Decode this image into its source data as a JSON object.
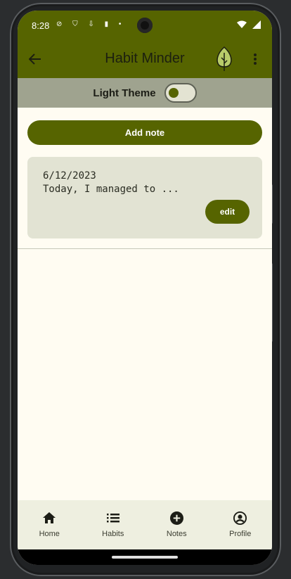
{
  "status_bar": {
    "time": "8:28",
    "icons": "⊘ ⛉ ⇩ ▮ •"
  },
  "app_bar": {
    "title": "Habit Minder",
    "back_icon": "arrow-back-icon",
    "logo_icon": "leaf-logo-icon",
    "more_icon": "more-vert-icon"
  },
  "theme": {
    "label": "Light Theme",
    "toggle_on": false
  },
  "add_note_label": "Add note",
  "notes": [
    {
      "date": "6/12/2023",
      "text": "Today, I managed to ...",
      "edit_label": "edit"
    }
  ],
  "bottom_nav": [
    {
      "label": "Home",
      "icon": "home-icon"
    },
    {
      "label": "Habits",
      "icon": "list-icon"
    },
    {
      "label": "Notes",
      "icon": "add-circle-icon"
    },
    {
      "label": "Profile",
      "icon": "account-circle-icon"
    }
  ],
  "colors": {
    "primary": "#566400",
    "surface": "#fffcf2",
    "card": "#e2e3d3",
    "theme_row": "#9fa38f",
    "nav_bg": "#eeefe0"
  }
}
